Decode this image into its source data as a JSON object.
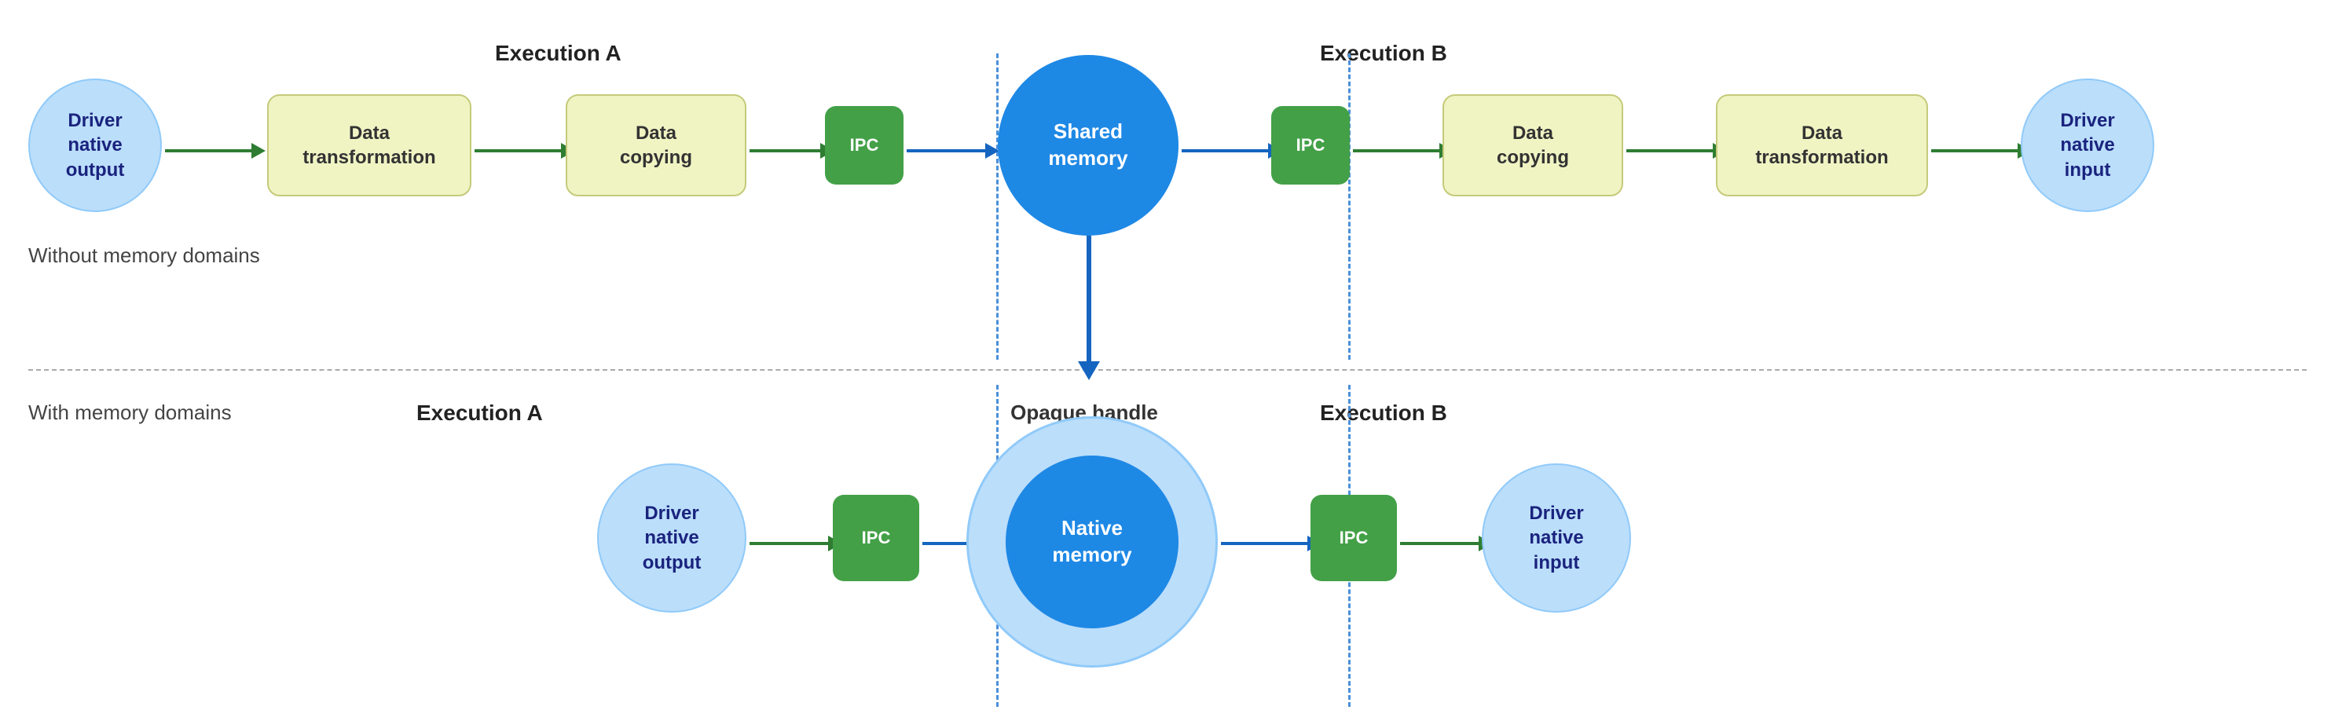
{
  "top_section_label": "Without memory domains",
  "bottom_section_label": "With memory domains",
  "execution_a_top": "Execution A",
  "execution_b_top": "Execution B",
  "execution_a_bottom": "Execution A",
  "execution_b_bottom": "Execution B",
  "opaque_handle_label": "Opaque handle",
  "nodes_top": [
    {
      "id": "driver-native-output-top",
      "type": "circle-light",
      "label": "Driver\nnative\noutput"
    },
    {
      "id": "data-transform-1",
      "type": "rect-light",
      "label": "Data\ntransformation"
    },
    {
      "id": "data-copying-1",
      "type": "rect-light",
      "label": "Data\ncopying"
    },
    {
      "id": "ipc-1",
      "type": "rect-green",
      "label": "IPC"
    },
    {
      "id": "shared-memory",
      "type": "circle-blue",
      "label": "Shared\nmemory"
    },
    {
      "id": "ipc-2",
      "type": "rect-green",
      "label": "IPC"
    },
    {
      "id": "data-copying-2",
      "type": "rect-light",
      "label": "Data\ncopying"
    },
    {
      "id": "data-transform-2",
      "type": "rect-light",
      "label": "Data\ntransformation"
    },
    {
      "id": "driver-native-input-top",
      "type": "circle-light",
      "label": "Driver\nnative\ninput"
    }
  ],
  "nodes_bottom": [
    {
      "id": "driver-native-output-bottom",
      "type": "circle-light",
      "label": "Driver\nnative\noutput"
    },
    {
      "id": "ipc-3",
      "type": "rect-green",
      "label": "IPC"
    },
    {
      "id": "native-memory",
      "type": "circle-blue-large",
      "label": "Native\nmemory"
    },
    {
      "id": "ipc-4",
      "type": "rect-green",
      "label": "IPC"
    },
    {
      "id": "driver-native-input-bottom",
      "type": "circle-light",
      "label": "Driver\nnative\ninput"
    }
  ],
  "colors": {
    "light_blue": "#bbdefb",
    "blue": "#1e88e5",
    "green": "#43a047",
    "light_green_rect": "#f0f4c3",
    "dashed_blue": "#4a90d9",
    "divider": "#aaa"
  }
}
